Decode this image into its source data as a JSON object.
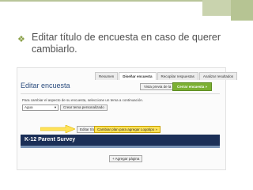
{
  "slide": {
    "bullet_text": "Editar título de encuesta en caso de querer cambiarlo.",
    "accent_color": "#8aa048"
  },
  "screenshot": {
    "tabs": [
      {
        "label": "Resumen",
        "active": false
      },
      {
        "label": "Diseñar encuesta",
        "active": true
      },
      {
        "label": "Recopilar respuestas",
        "active": false
      },
      {
        "label": "Analizar resultados",
        "active": false
      }
    ],
    "page_title": "Editar encuesta",
    "preview_button": "Vista previa de la encuesta",
    "create_button": "Cerrar encuesta »",
    "theme_help": "Para cambiar el aspecto de su encuesta, seleccione un tema a continuación.",
    "theme_select_value": "Agua",
    "create_theme_button": "Crear tema personalizado",
    "edit_title_button": "Editar título",
    "logo_button": "Cambiar plan para agregar Logotipo »",
    "survey_title": "K-12 Parent Survey",
    "add_page_button": "+ Agregar página",
    "banner_color": "#1b2f57",
    "highlight_color": "#ffe35a"
  }
}
